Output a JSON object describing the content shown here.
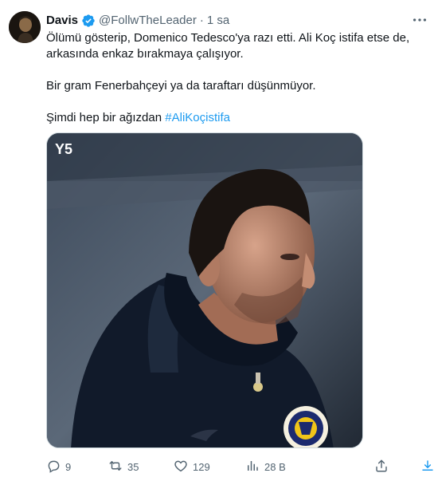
{
  "author": {
    "display_name": "Davis",
    "handle": "@FollwTheLeader",
    "separator": "·",
    "timestamp": "1 sa",
    "verified_icon": "verified-badge-icon"
  },
  "tweet": {
    "line1": "Ölümü gösterip, Domenico Tedesco'ya razı etti. Ali Koç istifa etse de, arkasında enkaz bırakmaya çalışıyor.",
    "line2": "Bir gram Fenerbahçeyi ya da taraftarı düşünmüyor.",
    "line3_prefix": "Şimdi hep bir ağızdan ",
    "hashtag": "#AliKoçistifa"
  },
  "media": {
    "watermark": "Y5"
  },
  "actions": {
    "reply_count": "9",
    "retweet_count": "35",
    "like_count": "129",
    "views_count": "28 B"
  },
  "colors": {
    "accent": "#1d9bf0",
    "retweet": "#00ba7c",
    "muted": "#536471"
  }
}
